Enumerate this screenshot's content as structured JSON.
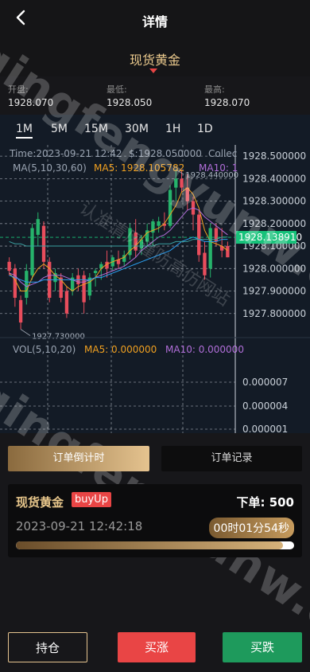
{
  "header": {
    "title": "详情",
    "back_icon": "chevron-left-icon"
  },
  "symbol": {
    "name": "现货黄金",
    "caret_color": "#e64545"
  },
  "stats": [
    {
      "label": "开盘:",
      "value": "1928.070"
    },
    {
      "label": "最低:",
      "value": "1928.050"
    },
    {
      "label": "最高:",
      "value": "1928.070"
    }
  ],
  "timeframes": [
    "1M",
    "5M",
    "15M",
    "30M",
    "1H",
    "1D"
  ],
  "active_timeframe": "1M",
  "chart": {
    "info_time": "Time:2023-09-21 12:42",
    "info_price": "$:1928.050000",
    "info_collect": "Collec",
    "ma_label": "MA(5,10,30,60)",
    "ma5_label": "MA5: 1928.105782",
    "ma10_label": "MA10: 1",
    "vol_label": "VOL(5,10,20)",
    "vol_ma5_label": "MA5: 0.000000",
    "vol_ma10_label": "MA10: 0.000000",
    "current_price_label": "1928.138910",
    "high_marker": "1928.440000",
    "low_marker": "1927.730000",
    "watermark": "qingfengyunw.com",
    "watermark_cn": "认准清风谨防高仿网站",
    "colors": {
      "up": "#26b36b",
      "down": "#e84d5c",
      "ma5": "#f0a020",
      "ma10": "#b06ed8",
      "ma30": "#2a9ff0",
      "ma60": "#3aa0a0",
      "current": "#17c27a"
    }
  },
  "chart_data": [
    {
      "type": "candlestick",
      "y_ticks": [
        "1928.500000",
        "1928.400000",
        "1928.300000",
        "1928.200000",
        "1928.100000",
        "1928.000000",
        "1927.900000",
        "1927.800000"
      ],
      "ylim": [
        1927.7,
        1928.55
      ],
      "candles": [
        {
          "o": 1928.03,
          "h": 1928.05,
          "l": 1927.97,
          "c": 1927.99
        },
        {
          "o": 1928.0,
          "h": 1928.02,
          "l": 1927.83,
          "c": 1927.87
        },
        {
          "o": 1927.86,
          "h": 1927.88,
          "l": 1927.73,
          "c": 1927.76
        },
        {
          "o": 1927.87,
          "h": 1928.02,
          "l": 1927.84,
          "c": 1927.99
        },
        {
          "o": 1927.97,
          "h": 1928.2,
          "l": 1927.95,
          "c": 1928.18
        },
        {
          "o": 1928.15,
          "h": 1928.25,
          "l": 1928.1,
          "c": 1928.22
        },
        {
          "o": 1928.19,
          "h": 1928.21,
          "l": 1928.0,
          "c": 1928.03
        },
        {
          "o": 1928.03,
          "h": 1928.05,
          "l": 1927.85,
          "c": 1927.87
        },
        {
          "o": 1927.94,
          "h": 1928.0,
          "l": 1927.9,
          "c": 1927.98
        },
        {
          "o": 1927.96,
          "h": 1927.98,
          "l": 1927.85,
          "c": 1927.87
        },
        {
          "o": 1927.9,
          "h": 1927.92,
          "l": 1927.78,
          "c": 1927.8
        },
        {
          "o": 1927.9,
          "h": 1927.98,
          "l": 1927.88,
          "c": 1927.96
        },
        {
          "o": 1927.97,
          "h": 1928.0,
          "l": 1927.9,
          "c": 1927.93
        },
        {
          "o": 1927.97,
          "h": 1927.99,
          "l": 1927.8,
          "c": 1927.85
        },
        {
          "o": 1927.88,
          "h": 1927.98,
          "l": 1927.86,
          "c": 1927.96
        },
        {
          "o": 1927.98,
          "h": 1928.0,
          "l": 1927.92,
          "c": 1927.99
        },
        {
          "o": 1928.0,
          "h": 1928.03,
          "l": 1927.95,
          "c": 1928.02
        },
        {
          "o": 1928.03,
          "h": 1928.08,
          "l": 1927.96,
          "c": 1928.0
        },
        {
          "o": 1928.01,
          "h": 1928.06,
          "l": 1927.99,
          "c": 1928.05
        },
        {
          "o": 1928.04,
          "h": 1928.08,
          "l": 1928.0,
          "c": 1928.02
        },
        {
          "o": 1928.03,
          "h": 1928.08,
          "l": 1928.01,
          "c": 1928.06
        },
        {
          "o": 1928.06,
          "h": 1928.2,
          "l": 1928.04,
          "c": 1928.18
        },
        {
          "o": 1928.16,
          "h": 1928.22,
          "l": 1928.05,
          "c": 1928.08
        },
        {
          "o": 1928.09,
          "h": 1928.15,
          "l": 1928.06,
          "c": 1928.13
        },
        {
          "o": 1928.12,
          "h": 1928.2,
          "l": 1928.1,
          "c": 1928.17
        },
        {
          "o": 1928.16,
          "h": 1928.22,
          "l": 1928.1,
          "c": 1928.21
        },
        {
          "o": 1928.19,
          "h": 1928.23,
          "l": 1928.16,
          "c": 1928.21
        },
        {
          "o": 1928.2,
          "h": 1928.25,
          "l": 1928.17,
          "c": 1928.19
        },
        {
          "o": 1928.19,
          "h": 1928.37,
          "l": 1928.18,
          "c": 1928.35
        },
        {
          "o": 1928.36,
          "h": 1928.44,
          "l": 1928.3,
          "c": 1928.4
        },
        {
          "o": 1928.4,
          "h": 1928.44,
          "l": 1928.34,
          "c": 1928.36
        },
        {
          "o": 1928.36,
          "h": 1928.42,
          "l": 1928.26,
          "c": 1928.3
        },
        {
          "o": 1928.3,
          "h": 1928.32,
          "l": 1928.17,
          "c": 1928.24
        },
        {
          "o": 1928.24,
          "h": 1928.26,
          "l": 1928.03,
          "c": 1928.06
        },
        {
          "o": 1928.07,
          "h": 1928.12,
          "l": 1927.95,
          "c": 1927.97
        },
        {
          "o": 1928.0,
          "h": 1928.2,
          "l": 1927.96,
          "c": 1928.18
        },
        {
          "o": 1928.18,
          "h": 1928.2,
          "l": 1928.1,
          "c": 1928.12
        },
        {
          "o": 1928.1,
          "h": 1928.18,
          "l": 1928.05,
          "c": 1928.08
        },
        {
          "o": 1928.1,
          "h": 1928.12,
          "l": 1928.05,
          "c": 1928.05
        }
      ],
      "ma_values": {
        "ma5": [
          1927.98,
          1927.95,
          1927.9,
          1927.9,
          1927.96,
          1928.0,
          1928.02,
          1928.0,
          1927.97,
          1927.95,
          1927.92,
          1927.9,
          1927.92,
          1927.93,
          1927.94,
          1927.96,
          1928.0,
          1928.02,
          1928.03,
          1928.04,
          1928.05,
          1928.08,
          1928.1,
          1928.13,
          1928.16,
          1928.17,
          1928.18,
          1928.2,
          1928.24,
          1928.28,
          1928.34,
          1928.36,
          1928.33,
          1928.27,
          1928.17,
          1928.12,
          1928.11,
          1928.1,
          1928.08
        ],
        "ma10": [
          1927.98,
          1927.97,
          1927.94,
          1927.92,
          1927.93,
          1927.94,
          1927.96,
          1927.97,
          1927.97,
          1927.97,
          1927.96,
          1927.95,
          1927.94,
          1927.94,
          1927.95,
          1927.96,
          1927.97,
          1927.98,
          1927.99,
          1928.0,
          1928.01,
          1928.03,
          1928.05,
          1928.08,
          1928.1,
          1928.12,
          1928.14,
          1928.15,
          1928.17,
          1928.2,
          1928.23,
          1928.26,
          1928.27,
          1928.26,
          1928.23,
          1928.21,
          1928.19,
          1928.17,
          1928.15
        ],
        "ma30": [
          1927.97,
          1927.96,
          1927.95,
          1927.94,
          1927.94,
          1927.94,
          1927.95,
          1927.95,
          1927.95,
          1927.95,
          1927.95,
          1927.95,
          1927.95,
          1927.95,
          1927.95,
          1927.96,
          1927.96,
          1927.97,
          1927.98,
          1927.99,
          1928.0,
          1928.01,
          1928.02,
          1928.03,
          1928.04,
          1928.05,
          1928.06,
          1928.07,
          1928.08,
          1928.1,
          1928.12,
          1928.13,
          1928.14,
          1928.13,
          1928.12,
          1928.12,
          1928.12,
          1928.13,
          1928.13
        ],
        "ma60": [
          1928.12,
          1928.11,
          1928.11,
          1928.1,
          1928.1,
          1928.1,
          1928.1,
          1928.1,
          1928.1,
          1928.1,
          1928.1,
          1928.1,
          1928.1,
          1928.1,
          1928.1,
          1928.1,
          1928.1,
          1928.1,
          1928.1,
          1928.1,
          1928.1,
          1928.1,
          1928.1,
          1928.1,
          1928.1,
          1928.1,
          1928.11,
          1928.11,
          1928.11,
          1928.12,
          1928.12,
          1928.12,
          1928.13,
          1928.13,
          1928.13,
          1928.13,
          1928.13,
          1928.14,
          1928.14
        ]
      },
      "current_price": 1928.13891
    },
    {
      "type": "bar",
      "title": "VOL(5,10,20)",
      "y_ticks": [
        "0.000007",
        "0.000004",
        "0.000001"
      ],
      "values": []
    }
  ],
  "order_tabs": [
    "订单倒计时",
    "订单记录"
  ],
  "order": {
    "name": "现货黄金",
    "direction": "buyUp",
    "amount_label": "下单:",
    "amount": "500",
    "time": "2023-09-21 12:42:18",
    "countdown": "00时01分54秒",
    "progress": 0.96
  },
  "bottom_buttons": {
    "hold": "持仓",
    "buy_up": "买涨",
    "buy_down": "买跌"
  }
}
